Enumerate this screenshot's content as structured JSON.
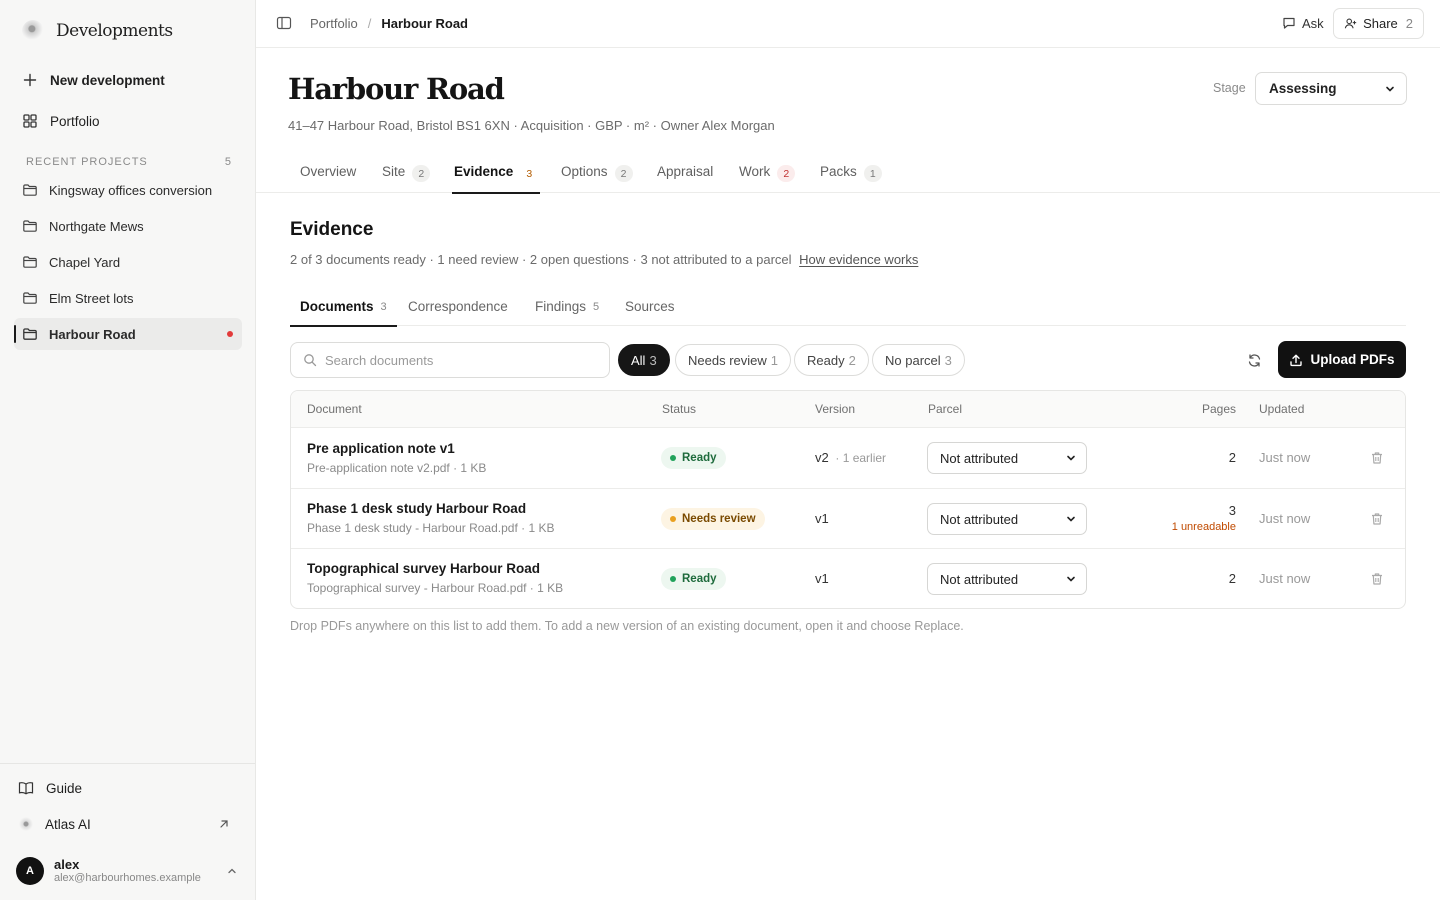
{
  "app": {
    "name": "Developments"
  },
  "sidebar": {
    "new_label": "New development",
    "portfolio_label": "Portfolio",
    "recent_heading": "RECENT PROJECTS",
    "recent_count": "5",
    "projects": [
      {
        "label": "Kingsway offices conversion"
      },
      {
        "label": "Northgate Mews"
      },
      {
        "label": "Chapel Yard"
      },
      {
        "label": "Elm Street lots"
      },
      {
        "label": "Harbour Road",
        "active": true
      }
    ],
    "guide_label": "Guide",
    "atlas_label": "Atlas AI",
    "user": {
      "initial": "A",
      "name": "alex",
      "email": "alex@harbourhomes.example"
    }
  },
  "topbar": {
    "crumbs": [
      "Portfolio",
      "Harbour Road"
    ],
    "ask_label": "Ask",
    "share_label": "Share",
    "share_count": "2"
  },
  "header": {
    "title": "Harbour Road",
    "subtitle": "41–47 Harbour Road, Bristol BS1 6XN · Acquisition · GBP · m² · Owner Alex Morgan",
    "stage_label": "Stage",
    "stage_value": "Assessing"
  },
  "tabs": [
    {
      "label": "Overview",
      "badge": ""
    },
    {
      "label": "Site",
      "badge": "2"
    },
    {
      "label": "Evidence",
      "badge": "3",
      "active": true
    },
    {
      "label": "Options",
      "badge": "2"
    },
    {
      "label": "Appraisal",
      "badge": ""
    },
    {
      "label": "Work",
      "badge": "2"
    },
    {
      "label": "Packs",
      "badge": "1"
    }
  ],
  "evidence": {
    "title": "Evidence",
    "summary": "2 of 3 documents ready · 1 need review · 2 open questions · 3 not attributed to a parcel",
    "help_link": "How evidence works",
    "subtabs": [
      {
        "label": "Documents",
        "count": "3",
        "active": true
      },
      {
        "label": "Correspondence",
        "count": ""
      },
      {
        "label": "Findings",
        "count": "5"
      },
      {
        "label": "Sources",
        "count": ""
      }
    ],
    "search_placeholder": "Search documents",
    "filters": [
      {
        "label": "All",
        "count": "3",
        "active": true
      },
      {
        "label": "Needs review",
        "count": "1"
      },
      {
        "label": "Ready",
        "count": "2"
      },
      {
        "label": "No parcel",
        "count": "3"
      }
    ],
    "upload_label": "Upload PDFs",
    "columns": [
      "Document",
      "Status",
      "Version",
      "Parcel",
      "Pages",
      "Updated"
    ],
    "rows": [
      {
        "name": "Pre application note v1",
        "file": "Pre-application note v2.pdf · 1 KB",
        "status": "Ready",
        "version": "v2",
        "version_note": "· 1 earlier",
        "parcel": "Not attributed",
        "pages": "2",
        "pages_note": "",
        "updated": "Just now"
      },
      {
        "name": "Phase 1 desk study Harbour Road",
        "file": "Phase 1 desk study - Harbour Road.pdf · 1 KB",
        "status": "Needs review",
        "version": "v1",
        "version_note": "",
        "parcel": "Not attributed",
        "pages": "3",
        "pages_note": "1 unreadable",
        "updated": "Just now"
      },
      {
        "name": "Topographical survey Harbour Road",
        "file": "Topographical survey - Harbour Road.pdf · 1 KB",
        "status": "Ready",
        "version": "v1",
        "version_note": "",
        "parcel": "Not attributed",
        "pages": "2",
        "pages_note": "",
        "updated": "Just now"
      }
    ],
    "drop_hint": "Drop PDFs anywhere on this list to add them. To add a new version of an existing document, open it and choose Replace."
  }
}
